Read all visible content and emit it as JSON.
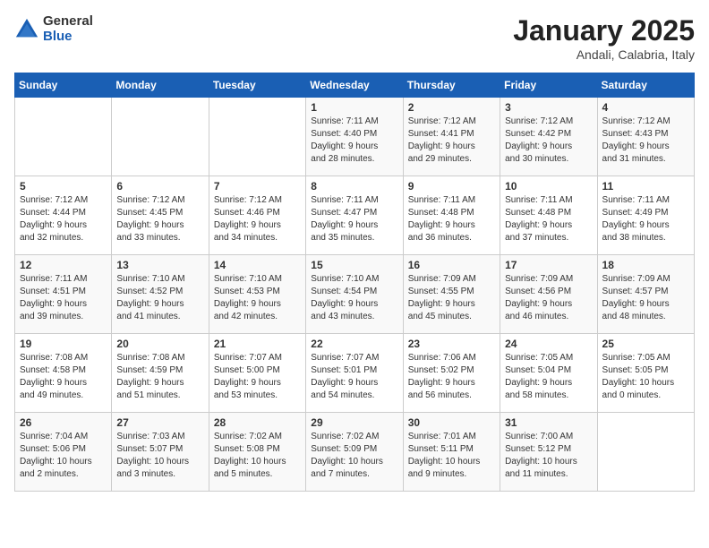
{
  "header": {
    "logo_general": "General",
    "logo_blue": "Blue",
    "title": "January 2025",
    "subtitle": "Andali, Calabria, Italy"
  },
  "weekdays": [
    "Sunday",
    "Monday",
    "Tuesday",
    "Wednesday",
    "Thursday",
    "Friday",
    "Saturday"
  ],
  "weeks": [
    [
      {
        "day": "",
        "info": ""
      },
      {
        "day": "",
        "info": ""
      },
      {
        "day": "",
        "info": ""
      },
      {
        "day": "1",
        "info": "Sunrise: 7:11 AM\nSunset: 4:40 PM\nDaylight: 9 hours\nand 28 minutes."
      },
      {
        "day": "2",
        "info": "Sunrise: 7:12 AM\nSunset: 4:41 PM\nDaylight: 9 hours\nand 29 minutes."
      },
      {
        "day": "3",
        "info": "Sunrise: 7:12 AM\nSunset: 4:42 PM\nDaylight: 9 hours\nand 30 minutes."
      },
      {
        "day": "4",
        "info": "Sunrise: 7:12 AM\nSunset: 4:43 PM\nDaylight: 9 hours\nand 31 minutes."
      }
    ],
    [
      {
        "day": "5",
        "info": "Sunrise: 7:12 AM\nSunset: 4:44 PM\nDaylight: 9 hours\nand 32 minutes."
      },
      {
        "day": "6",
        "info": "Sunrise: 7:12 AM\nSunset: 4:45 PM\nDaylight: 9 hours\nand 33 minutes."
      },
      {
        "day": "7",
        "info": "Sunrise: 7:12 AM\nSunset: 4:46 PM\nDaylight: 9 hours\nand 34 minutes."
      },
      {
        "day": "8",
        "info": "Sunrise: 7:11 AM\nSunset: 4:47 PM\nDaylight: 9 hours\nand 35 minutes."
      },
      {
        "day": "9",
        "info": "Sunrise: 7:11 AM\nSunset: 4:48 PM\nDaylight: 9 hours\nand 36 minutes."
      },
      {
        "day": "10",
        "info": "Sunrise: 7:11 AM\nSunset: 4:48 PM\nDaylight: 9 hours\nand 37 minutes."
      },
      {
        "day": "11",
        "info": "Sunrise: 7:11 AM\nSunset: 4:49 PM\nDaylight: 9 hours\nand 38 minutes."
      }
    ],
    [
      {
        "day": "12",
        "info": "Sunrise: 7:11 AM\nSunset: 4:51 PM\nDaylight: 9 hours\nand 39 minutes."
      },
      {
        "day": "13",
        "info": "Sunrise: 7:10 AM\nSunset: 4:52 PM\nDaylight: 9 hours\nand 41 minutes."
      },
      {
        "day": "14",
        "info": "Sunrise: 7:10 AM\nSunset: 4:53 PM\nDaylight: 9 hours\nand 42 minutes."
      },
      {
        "day": "15",
        "info": "Sunrise: 7:10 AM\nSunset: 4:54 PM\nDaylight: 9 hours\nand 43 minutes."
      },
      {
        "day": "16",
        "info": "Sunrise: 7:09 AM\nSunset: 4:55 PM\nDaylight: 9 hours\nand 45 minutes."
      },
      {
        "day": "17",
        "info": "Sunrise: 7:09 AM\nSunset: 4:56 PM\nDaylight: 9 hours\nand 46 minutes."
      },
      {
        "day": "18",
        "info": "Sunrise: 7:09 AM\nSunset: 4:57 PM\nDaylight: 9 hours\nand 48 minutes."
      }
    ],
    [
      {
        "day": "19",
        "info": "Sunrise: 7:08 AM\nSunset: 4:58 PM\nDaylight: 9 hours\nand 49 minutes."
      },
      {
        "day": "20",
        "info": "Sunrise: 7:08 AM\nSunset: 4:59 PM\nDaylight: 9 hours\nand 51 minutes."
      },
      {
        "day": "21",
        "info": "Sunrise: 7:07 AM\nSunset: 5:00 PM\nDaylight: 9 hours\nand 53 minutes."
      },
      {
        "day": "22",
        "info": "Sunrise: 7:07 AM\nSunset: 5:01 PM\nDaylight: 9 hours\nand 54 minutes."
      },
      {
        "day": "23",
        "info": "Sunrise: 7:06 AM\nSunset: 5:02 PM\nDaylight: 9 hours\nand 56 minutes."
      },
      {
        "day": "24",
        "info": "Sunrise: 7:05 AM\nSunset: 5:04 PM\nDaylight: 9 hours\nand 58 minutes."
      },
      {
        "day": "25",
        "info": "Sunrise: 7:05 AM\nSunset: 5:05 PM\nDaylight: 10 hours\nand 0 minutes."
      }
    ],
    [
      {
        "day": "26",
        "info": "Sunrise: 7:04 AM\nSunset: 5:06 PM\nDaylight: 10 hours\nand 2 minutes."
      },
      {
        "day": "27",
        "info": "Sunrise: 7:03 AM\nSunset: 5:07 PM\nDaylight: 10 hours\nand 3 minutes."
      },
      {
        "day": "28",
        "info": "Sunrise: 7:02 AM\nSunset: 5:08 PM\nDaylight: 10 hours\nand 5 minutes."
      },
      {
        "day": "29",
        "info": "Sunrise: 7:02 AM\nSunset: 5:09 PM\nDaylight: 10 hours\nand 7 minutes."
      },
      {
        "day": "30",
        "info": "Sunrise: 7:01 AM\nSunset: 5:11 PM\nDaylight: 10 hours\nand 9 minutes."
      },
      {
        "day": "31",
        "info": "Sunrise: 7:00 AM\nSunset: 5:12 PM\nDaylight: 10 hours\nand 11 minutes."
      },
      {
        "day": "",
        "info": ""
      }
    ]
  ]
}
